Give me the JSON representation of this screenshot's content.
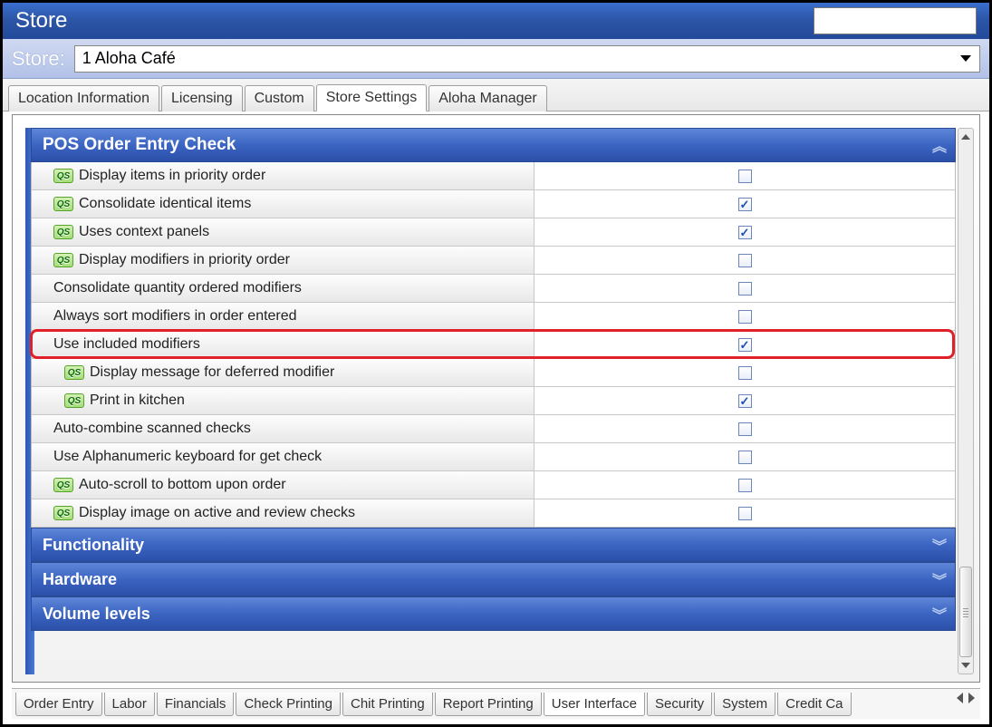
{
  "header": {
    "title": "Store"
  },
  "store_selector": {
    "label": "Store:",
    "selected": "1 Aloha Café"
  },
  "top_tabs": [
    {
      "label": "Location Information",
      "active": false
    },
    {
      "label": "Licensing",
      "active": false
    },
    {
      "label": "Custom",
      "active": false
    },
    {
      "label": "Store Settings",
      "active": true
    },
    {
      "label": "Aloha Manager",
      "active": false
    }
  ],
  "sections": {
    "pos_order_entry": {
      "title": "POS Order Entry Check",
      "expanded": true,
      "rows": [
        {
          "label": "Display items in priority order",
          "qs": true,
          "indent": 1,
          "checked": false
        },
        {
          "label": "Consolidate identical items",
          "qs": true,
          "indent": 1,
          "checked": true
        },
        {
          "label": "Uses context panels",
          "qs": true,
          "indent": 1,
          "checked": true
        },
        {
          "label": "Display modifiers in priority order",
          "qs": true,
          "indent": 1,
          "checked": false
        },
        {
          "label": "Consolidate quantity ordered modifiers",
          "qs": false,
          "indent": 1,
          "checked": false
        },
        {
          "label": "Always sort modifiers in order entered",
          "qs": false,
          "indent": 1,
          "checked": false
        },
        {
          "label": "Use included modifiers",
          "qs": false,
          "indent": 1,
          "checked": true,
          "highlighted": true
        },
        {
          "label": "Display message for deferred modifier",
          "qs": true,
          "indent": 2,
          "checked": false
        },
        {
          "label": "Print in kitchen",
          "qs": true,
          "indent": 2,
          "checked": true
        },
        {
          "label": "Auto-combine scanned checks",
          "qs": false,
          "indent": 1,
          "checked": false
        },
        {
          "label": "Use Alphanumeric keyboard for get check",
          "qs": false,
          "indent": 1,
          "checked": false
        },
        {
          "label": "Auto-scroll to bottom upon order",
          "qs": true,
          "indent": 1,
          "checked": false
        },
        {
          "label": "Display image on active and review checks",
          "qs": true,
          "indent": 1,
          "checked": false
        }
      ]
    },
    "functionality": {
      "title": "Functionality",
      "expanded": false
    },
    "hardware": {
      "title": "Hardware",
      "expanded": false
    },
    "volume_levels": {
      "title": "Volume levels",
      "expanded": false
    }
  },
  "bottom_tabs": [
    {
      "label": "Order Entry",
      "active": false
    },
    {
      "label": "Labor",
      "active": false
    },
    {
      "label": "Financials",
      "active": false
    },
    {
      "label": "Check Printing",
      "active": false
    },
    {
      "label": "Chit Printing",
      "active": false
    },
    {
      "label": "Report Printing",
      "active": false
    },
    {
      "label": "User Interface",
      "active": true
    },
    {
      "label": "Security",
      "active": false
    },
    {
      "label": "System",
      "active": false
    },
    {
      "label": "Credit Ca",
      "active": false
    }
  ],
  "icons": {
    "qs_label": "QS"
  }
}
